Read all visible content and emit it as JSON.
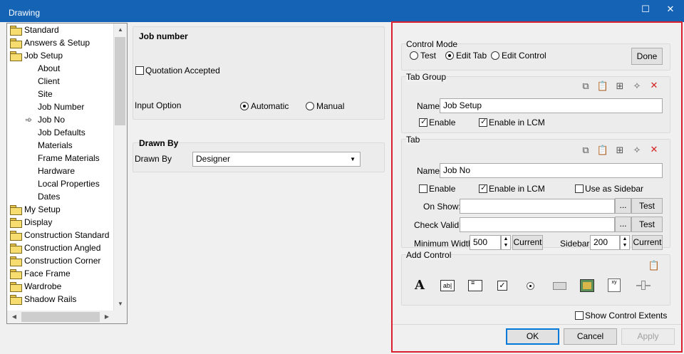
{
  "window": {
    "title": "Drawing",
    "maximize_icon": "maximize-icon",
    "close_icon": "close-icon"
  },
  "tree": {
    "items": [
      {
        "label": "Standard",
        "type": "folder",
        "level": 0
      },
      {
        "label": "Answers & Setup",
        "type": "folder",
        "level": 0
      },
      {
        "label": "Job Setup",
        "type": "folder",
        "level": 0
      },
      {
        "label": "About",
        "type": "item",
        "level": 1
      },
      {
        "label": "Client",
        "type": "item",
        "level": 1
      },
      {
        "label": "Site",
        "type": "item",
        "level": 1
      },
      {
        "label": "Job Number",
        "type": "item",
        "level": 1
      },
      {
        "label": "Job No",
        "type": "item",
        "level": 1,
        "selected": true
      },
      {
        "label": "Job Defaults",
        "type": "item",
        "level": 1
      },
      {
        "label": "Materials",
        "type": "item",
        "level": 1
      },
      {
        "label": "Frame Materials",
        "type": "item",
        "level": 1
      },
      {
        "label": "Hardware",
        "type": "item",
        "level": 1
      },
      {
        "label": "Local Properties",
        "type": "item",
        "level": 1
      },
      {
        "label": "Dates",
        "type": "item",
        "level": 1
      },
      {
        "label": "My Setup",
        "type": "folder",
        "level": 0
      },
      {
        "label": "Display",
        "type": "folder",
        "level": 0
      },
      {
        "label": "Construction Standard",
        "type": "folder",
        "level": 0
      },
      {
        "label": "Construction Angled",
        "type": "folder",
        "level": 0
      },
      {
        "label": "Construction Corner",
        "type": "folder",
        "level": 0
      },
      {
        "label": "Face Frame",
        "type": "folder",
        "level": 0
      },
      {
        "label": "Wardrobe",
        "type": "folder",
        "level": 0
      },
      {
        "label": "Shadow Rails",
        "type": "folder",
        "level": 0
      }
    ]
  },
  "job_number": {
    "title": "Job number",
    "quotation_label": "Quotation Accepted",
    "quotation_checked": false,
    "input_option_label": "Input Option",
    "automatic_label": "Automatic",
    "manual_label": "Manual",
    "selected": "Automatic"
  },
  "drawn_by": {
    "title": "Drawn By",
    "label": "Drawn By",
    "value": "Designer"
  },
  "control_mode": {
    "title": "Control Mode",
    "test_label": "Test",
    "edit_tab_label": "Edit Tab",
    "edit_control_label": "Edit Control",
    "selected": "Edit Tab",
    "done_label": "Done"
  },
  "tab_group": {
    "title": "Tab Group",
    "name_label": "Name:",
    "name_value": "Job Setup",
    "enable_label": "Enable",
    "enable_checked": true,
    "lcm_label": "Enable in LCM",
    "lcm_checked": true
  },
  "tab": {
    "title": "Tab",
    "name_label": "Name:",
    "name_value": "Job No",
    "enable_label": "Enable",
    "enable_checked": false,
    "lcm_label": "Enable in LCM",
    "lcm_checked": true,
    "sidebar_label": "Use as Sidebar",
    "sidebar_checked": false,
    "on_show_label": "On Show:",
    "on_show_value": "",
    "check_valid_label": "Check Valid:",
    "check_valid_value": "",
    "ellipsis": "...",
    "test_label": "Test",
    "min_width_label": "Minimum Width:",
    "min_width_value": "500",
    "current_label": "Current",
    "sidebar_w_label": "Sidebar:",
    "sidebar_w_value": "200"
  },
  "add_control": {
    "title": "Add Control",
    "paste_icon": "paste-icon",
    "controls": [
      "label-control-icon",
      "textbox-control-icon",
      "listbox-control-icon",
      "checkbox-control-icon",
      "radio-control-icon",
      "button-control-icon",
      "picture-control-icon",
      "variable-control-icon",
      "slider-control-icon"
    ]
  },
  "toolbar_icons": [
    "copy-icon",
    "paste-icon",
    "add-item-icon",
    "new-icon",
    "delete-icon"
  ],
  "show_extents": {
    "label": "Show Control Extents",
    "checked": false
  },
  "buttons": {
    "ok": "OK",
    "cancel": "Cancel",
    "apply": "Apply"
  }
}
